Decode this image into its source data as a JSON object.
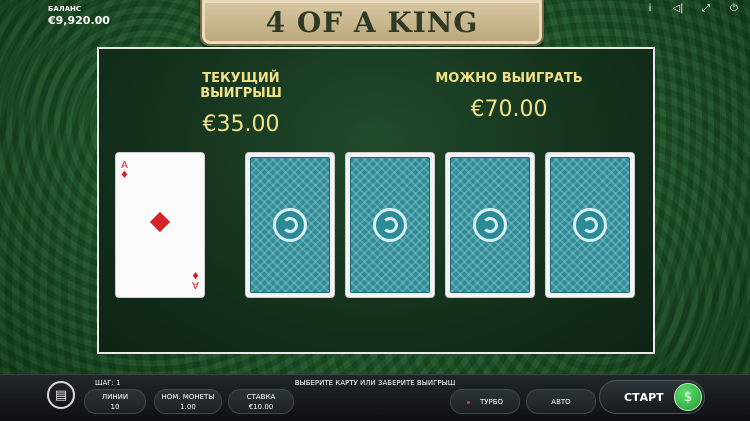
{
  "header": {
    "balance_label": "БАЛАНС",
    "balance_value": "€9,920.00",
    "game_title": "4 OF A KING",
    "icons": [
      "info-icon",
      "sound-icon",
      "fullscreen-icon",
      "power-icon"
    ],
    "info_glyph": "i",
    "sound_glyph": "◁⃒",
    "fullscreen_glyph": "⤢",
    "power_glyph": "⏻"
  },
  "gamble": {
    "current_win_label": "ТЕКУЩИЙ ВЫИГРЫШ",
    "current_win_value": "€35.00",
    "can_win_label": "МОЖНО ВЫИГРАТЬ",
    "can_win_value": "€70.00",
    "dealer_card": {
      "rank": "A",
      "suit": "diamonds"
    },
    "face_down_cards": 4
  },
  "bottom": {
    "step_label": "ШАГ: 1",
    "message": "ВЫБЕРИТЕ КАРТУ ИЛИ ЗАБЕРИТЕ ВЫИГРЫШ",
    "lines_label": "ЛИНИИ",
    "lines_value": "10",
    "coin_label": "НОМ. МОНЕТЫ",
    "coin_value": "1.00",
    "bet_label": "СТАВКА",
    "bet_value": "€10.00",
    "turbo_label": "ТУРБО",
    "auto_label": "АВТО",
    "start_label": "СТАРТ"
  },
  "colors": {
    "table_green": "#1f5a2a",
    "panel_text": "#f1e28a",
    "card_back": "#2c8b97",
    "diamond_red": "#d3222a",
    "start_green": "#1f9a30"
  }
}
